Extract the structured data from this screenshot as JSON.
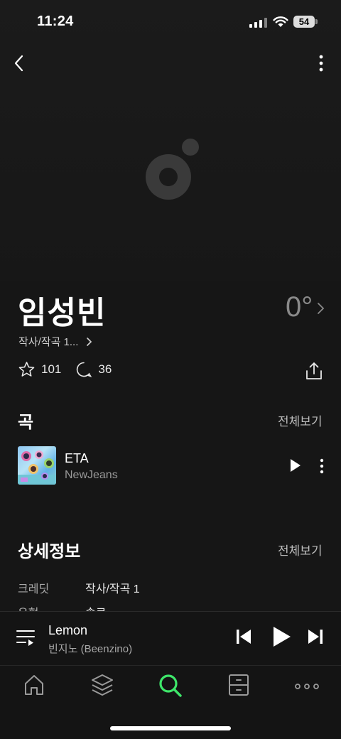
{
  "status_bar": {
    "time": "11:24",
    "battery": "54"
  },
  "artist": {
    "name": "임성빈",
    "temperature": "0°",
    "role": "작사/작곡 1...",
    "likes": "101",
    "comments": "36"
  },
  "songs_section": {
    "title": "곡",
    "see_all": "전체보기",
    "items": [
      {
        "title": "ETA",
        "artist": "NewJeans"
      }
    ]
  },
  "details_section": {
    "title": "상세정보",
    "see_all": "전체보기",
    "rows": [
      {
        "key": "크레딧",
        "value": "작사/작곡 1"
      },
      {
        "key": "유형",
        "value": "솔로"
      }
    ]
  },
  "mini_player": {
    "title": "Lemon",
    "artist": "빈지노 (Beenzino)"
  },
  "tabs": [
    {
      "icon": "home-icon",
      "active": false
    },
    {
      "icon": "layers-icon",
      "active": false
    },
    {
      "icon": "search-icon",
      "active": true
    },
    {
      "icon": "library-icon",
      "active": false
    },
    {
      "icon": "more-icon",
      "active": false
    }
  ],
  "colors": {
    "accent": "#3ee66a",
    "background": "#161616",
    "muted": "#9a9a9a"
  }
}
